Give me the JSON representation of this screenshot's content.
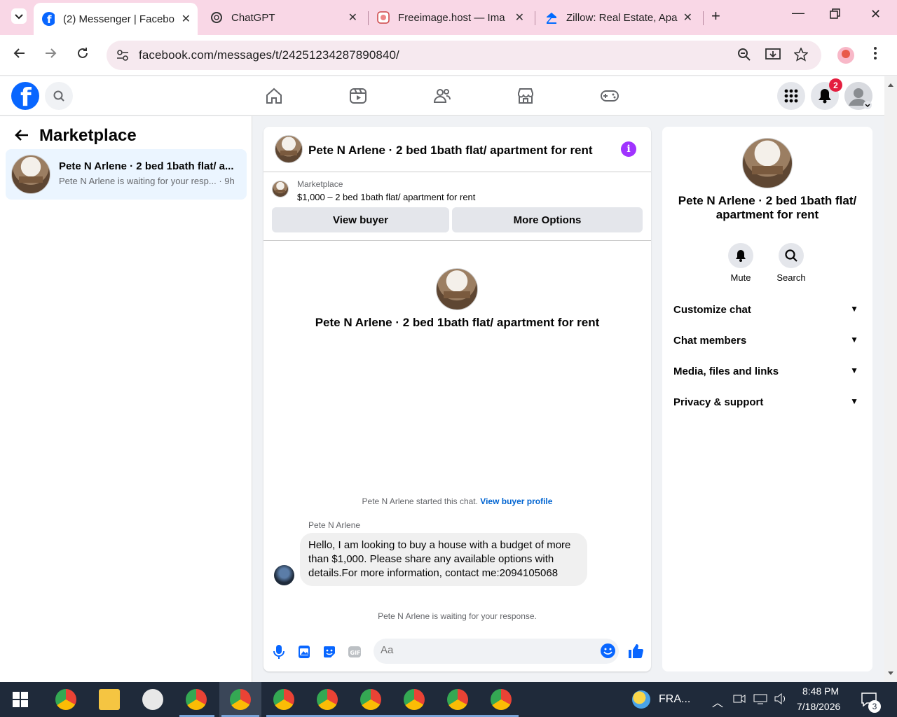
{
  "browser": {
    "tabs": [
      {
        "title": "(2) Messenger | Facebo",
        "icon": "facebook-icon"
      },
      {
        "title": "ChatGPT",
        "icon": "openai-icon"
      },
      {
        "title": "Freeimage.host — Ima",
        "icon": "freeimage-icon"
      },
      {
        "title": "Zillow: Real Estate, Apa",
        "icon": "zillow-icon"
      }
    ],
    "url": "facebook.com/messages/t/24251234287890840/"
  },
  "header": {
    "notif_count": "2"
  },
  "left": {
    "title": "Marketplace",
    "conversation": {
      "name": "Pete N Arlene · 2 bed 1bath flat/ a...",
      "preview": "Pete N Arlene is waiting for your resp...",
      "time": "· 9h"
    }
  },
  "chat": {
    "title": "Pete N Arlene · 2 bed 1bath flat/ apartment for rent",
    "marketplace_label": "Marketplace",
    "listing": "$1,000 – 2 bed 1bath flat/ apartment for rent",
    "view_buyer": "View buyer",
    "more_options": "More Options",
    "center_name": "Pete N Arlene · 2 bed 1bath flat/ apartment for rent",
    "started": "Pete N Arlene started this chat.",
    "view_buyer_profile": "View buyer profile",
    "sender": "Pete N Arlene",
    "message": "Hello, I am looking to buy a house with a budget of more than $1,000. Please share any available options with details.For more information, contact me:2094105068",
    "waiting": "Pete N Arlene is waiting for your response.",
    "composer_placeholder": "Aa"
  },
  "right": {
    "title": "Pete N Arlene · 2 bed 1bath flat/ apartment for rent",
    "mute": "Mute",
    "search": "Search",
    "rows": [
      "Customize chat",
      "Chat members",
      "Media, files and links",
      "Privacy & support"
    ]
  },
  "taskbar": {
    "weather": "FRA...",
    "time": "8:48 PM",
    "date": "7/18/2026",
    "notif": "3"
  }
}
